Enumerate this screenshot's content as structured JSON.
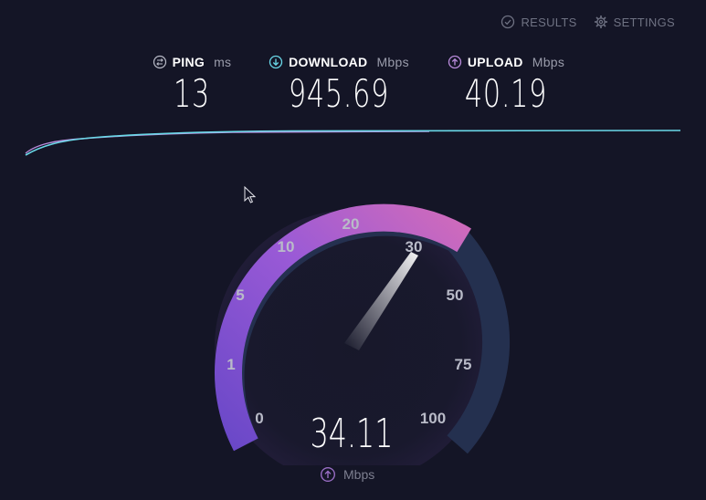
{
  "nav": {
    "results_label": "RESULTS",
    "settings_label": "SETTINGS",
    "results_icon": "check-circle-icon",
    "settings_icon": "gear-icon"
  },
  "metrics": {
    "ping": {
      "label": "PING",
      "unit": "ms",
      "value": "13",
      "icon": "ping-icon"
    },
    "download": {
      "label": "DOWNLOAD",
      "unit": "Mbps",
      "value": "945.69",
      "icon": "download-arrow-icon"
    },
    "upload": {
      "label": "UPLOAD",
      "unit": "Mbps",
      "value": "40.19",
      "icon": "upload-arrow-icon"
    }
  },
  "gauge": {
    "ticks": [
      "0",
      "1",
      "5",
      "10",
      "20",
      "30",
      "50",
      "75",
      "100"
    ],
    "current_value": "34.11",
    "unit": "Mbps",
    "unit_icon": "upload-arrow-icon"
  },
  "colors": {
    "background": "#141526",
    "download_accent": "#6ad8e8",
    "upload_accent": "#b98bdb",
    "gauge_fill_start": "#7a4fcf",
    "gauge_fill_end": "#cc66bb",
    "gauge_track": "#24304f"
  }
}
